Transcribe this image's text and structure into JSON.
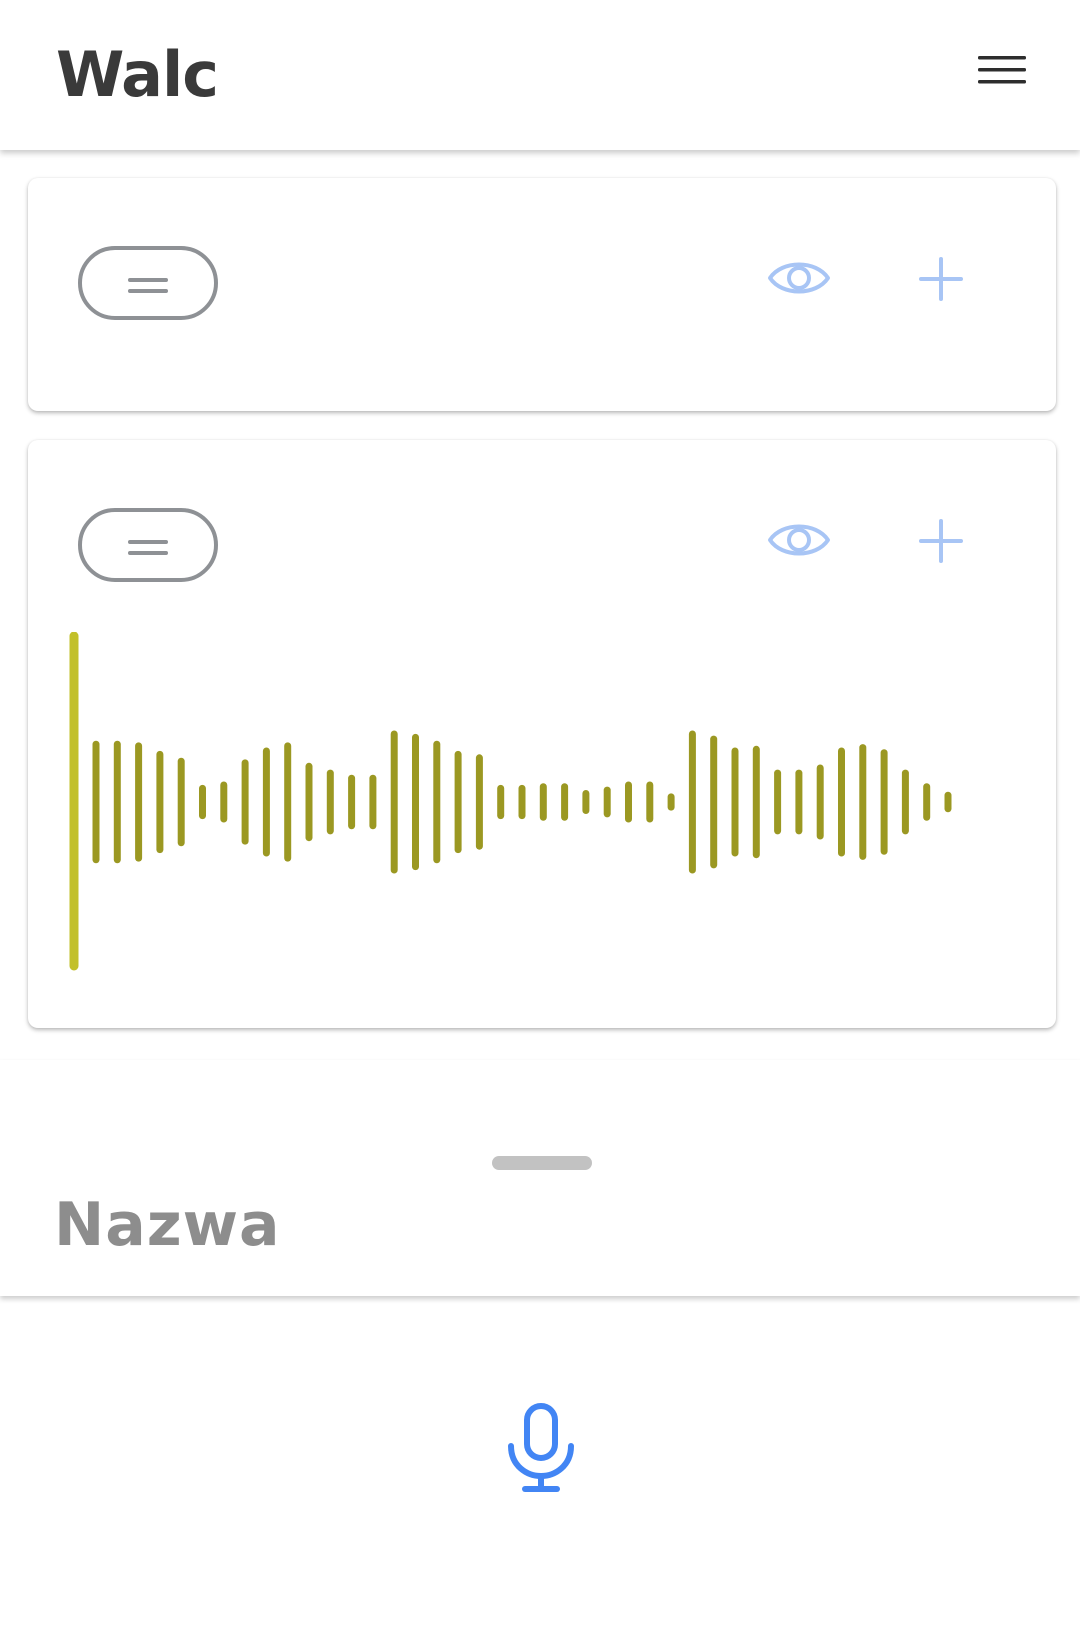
{
  "app": {
    "title": "Walc"
  },
  "header": {
    "menu_icon": "hamburger-menu-icon"
  },
  "tracks": [
    {
      "handle_icon": "drag-handle-icon",
      "visibility_icon": "eye-icon",
      "add_icon": "plus-icon",
      "has_waveform": false
    },
    {
      "handle_icon": "drag-handle-icon",
      "visibility_icon": "eye-icon",
      "add_icon": "plus-icon",
      "has_waveform": true
    }
  ],
  "waveform": {
    "playhead_color": "#c2c02a",
    "bar_color": "#9b9822",
    "playhead_position": 0,
    "amplitudes": [
      0.34,
      0.34,
      0.33,
      0.28,
      0.24,
      0.08,
      0.1,
      0.23,
      0.3,
      0.33,
      0.21,
      0.17,
      0.14,
      0.14,
      0.4,
      0.38,
      0.34,
      0.28,
      0.26,
      0.08,
      0.08,
      0.09,
      0.09,
      0.05,
      0.07,
      0.1,
      0.1,
      0.03,
      0.4,
      0.37,
      0.3,
      0.31,
      0.17,
      0.17,
      0.2,
      0.3,
      0.32,
      0.29,
      0.17,
      0.09,
      0.04
    ]
  },
  "sheet": {
    "name_placeholder": "Nazwa"
  },
  "colors": {
    "accent": "#4285f4",
    "icon_light": "#a8c5f5",
    "outline": "#8e9195"
  },
  "mic": {
    "icon": "microphone-icon"
  }
}
